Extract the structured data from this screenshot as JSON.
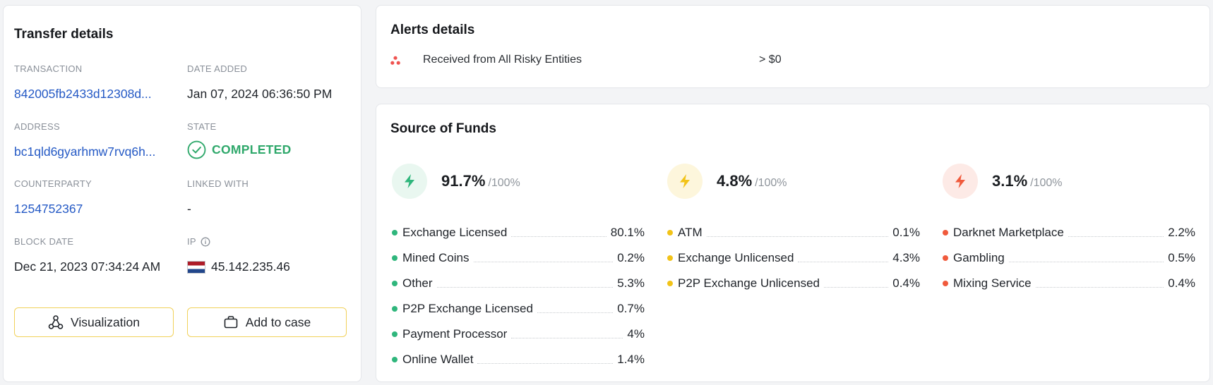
{
  "transfer": {
    "title": "Transfer details",
    "transaction_label": "TRANSACTION",
    "transaction_value": "842005fb2433d12308d...",
    "date_added_label": "DATE ADDED",
    "date_added_value": "Jan 07, 2024 06:36:50 PM",
    "address_label": "ADDRESS",
    "address_value": "bc1qld6gyarhmw7rvq6h...",
    "state_label": "STATE",
    "state_value": "COMPLETED",
    "counterparty_label": "COUNTERPARTY",
    "counterparty_value": "1254752367",
    "linked_label": "LINKED WITH",
    "linked_value": "-",
    "block_date_label": "BLOCK DATE",
    "block_date_value": "Dec 21, 2023 07:34:24 AM",
    "ip_label": "IP",
    "ip_value": "45.142.235.46",
    "visualization_label": "Visualization",
    "add_to_case_label": "Add to case"
  },
  "alerts": {
    "title": "Alerts details",
    "rows": [
      {
        "label": "Received from All Risky Entities",
        "value": "> $0"
      }
    ]
  },
  "sof": {
    "title": "Source of Funds",
    "of_label": "/100%",
    "columns": [
      {
        "percent": "91.7%",
        "color": "#2fb67c",
        "bg": "#e9f7f0",
        "items": [
          {
            "name": "Exchange Licensed",
            "value": "80.1%"
          },
          {
            "name": "Mined Coins",
            "value": "0.2%"
          },
          {
            "name": "Other",
            "value": "5.3%"
          },
          {
            "name": "P2P Exchange Licensed",
            "value": "0.7%"
          },
          {
            "name": "Payment Processor",
            "value": "4%"
          },
          {
            "name": "Online Wallet",
            "value": "1.4%"
          }
        ]
      },
      {
        "percent": "4.8%",
        "color": "#f2c318",
        "bg": "#fdf6dc",
        "items": [
          {
            "name": "ATM",
            "value": "0.1%"
          },
          {
            "name": "Exchange Unlicensed",
            "value": "4.3%"
          },
          {
            "name": "P2P Exchange Unlicensed",
            "value": "0.4%"
          }
        ]
      },
      {
        "percent": "3.1%",
        "color": "#f05a3c",
        "bg": "#fdeae6",
        "items": [
          {
            "name": "Darknet Marketplace",
            "value": "2.2%"
          },
          {
            "name": "Gambling",
            "value": "0.5%"
          },
          {
            "name": "Mixing Service",
            "value": "0.4%"
          }
        ]
      }
    ]
  },
  "colors": {
    "link": "#2459c5",
    "success": "#2fa86b",
    "button_border": "#f1d15a",
    "alert_icon": "#ef5350"
  }
}
